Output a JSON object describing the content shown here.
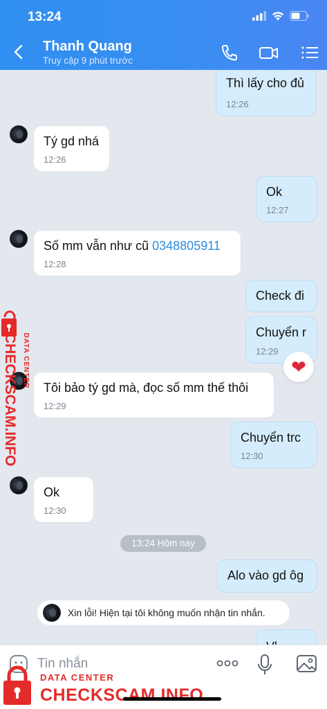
{
  "status_bar": {
    "time": "13:24"
  },
  "header": {
    "contact_name": "Thanh Quang",
    "contact_status": "Truy cập 9 phút trước",
    "accent_color": "#3a8df2"
  },
  "messages": [
    {
      "side": "out",
      "text": "Thì lấy cho đủ",
      "time": "12:26"
    },
    {
      "side": "in",
      "text": "Tý gd nhá",
      "time": "12:26"
    },
    {
      "side": "out",
      "text": "Ok",
      "time": "12:27"
    },
    {
      "side": "in",
      "text": "Số mm vẫn như cũ ",
      "phone": "0348805911",
      "time": "12:28"
    },
    {
      "side": "out",
      "text": "Check đi",
      "time": ""
    },
    {
      "side": "out",
      "text": "Chuyển r",
      "time": "12:29",
      "reaction": "heart"
    },
    {
      "side": "in",
      "text": "Tôi bảo tý gd mà, đọc số mm thế thôi",
      "time": "12:29"
    },
    {
      "side": "out",
      "text": "Chuyển trc",
      "time": "12:30"
    },
    {
      "side": "in",
      "text": "Ok",
      "time": "12:30"
    },
    {
      "side": "out",
      "text": "Alo vào gd ôg",
      "time": ""
    },
    {
      "side": "out",
      "text": "Vl",
      "time": ""
    }
  ],
  "day_separator": "13:24 Hôm nay",
  "block_notice": "Xin lỗi! Hiện tại tôi không muốn nhận tin nhắn.",
  "input": {
    "placeholder": "Tin nhắn"
  },
  "watermark": {
    "small": "DATA CENTER",
    "big": "CHECKSCAM.INFO",
    "color": "#e52a2a"
  }
}
